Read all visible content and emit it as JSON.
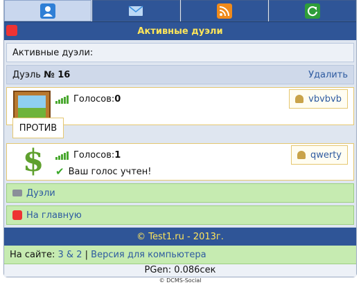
{
  "nav": [
    {
      "name": "user-icon",
      "color": "#2f7fd6",
      "active": true
    },
    {
      "name": "mail-icon",
      "color": "#3a8fe0",
      "active": false
    },
    {
      "name": "rss-icon",
      "color": "#f08a1b",
      "active": false
    },
    {
      "name": "refresh-icon",
      "color": "#2e9d3a",
      "active": false
    }
  ],
  "page_title": "Активные дуэли",
  "header_label": "Активные дуэли:",
  "duel": {
    "label": "Дуэль ",
    "number": "№ 16",
    "delete": "Удалить"
  },
  "contestant1": {
    "votes_label": "Голосов: ",
    "votes": "0",
    "user": "vbvbvb"
  },
  "versus": "ПРОТИВ",
  "contestant2": {
    "votes_label": "Голосов: ",
    "votes": "1",
    "confirm": "Ваш голос учтен!",
    "user": "qwerty"
  },
  "links": {
    "duels": "Дуэли",
    "home": "На главную"
  },
  "footer": "© Test1.ru - 2013г.",
  "online": {
    "label": "На сайте:",
    "count": "3 & 2",
    "separator": "|",
    "desktop": "Версия для компьютера"
  },
  "pgen": "PGen: 0.086сек",
  "copyright": "© DCMS-Social"
}
